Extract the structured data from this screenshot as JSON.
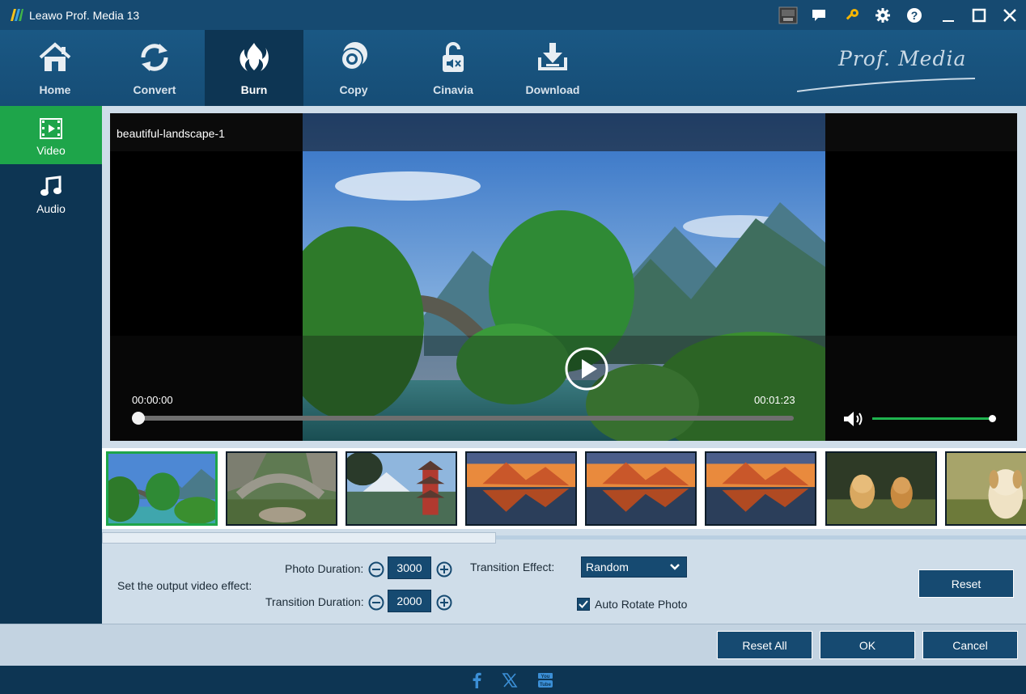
{
  "window": {
    "title": "Leawo Prof. Media 13",
    "controls": [
      "gpu-icon",
      "feedback-icon",
      "key-icon",
      "gear-icon",
      "help-icon",
      "minimize-icon",
      "maximize-icon",
      "close-icon"
    ]
  },
  "nav": {
    "items": [
      {
        "label": "Home",
        "icon": "home-icon"
      },
      {
        "label": "Convert",
        "icon": "convert-icon"
      },
      {
        "label": "Burn",
        "icon": "burn-icon",
        "active": true
      },
      {
        "label": "Copy",
        "icon": "copy-icon"
      },
      {
        "label": "Cinavia",
        "icon": "cinavia-icon"
      },
      {
        "label": "Download",
        "icon": "download-icon"
      }
    ],
    "brand": "Prof. Media"
  },
  "sidebar": {
    "items": [
      {
        "label": "Video",
        "icon": "video-icon",
        "active": true
      },
      {
        "label": "Audio",
        "icon": "music-icon"
      }
    ]
  },
  "player": {
    "file_name": "beautiful-landscape-1",
    "time_current": "00:00:00",
    "time_total": "00:01:23",
    "progress": 0.0,
    "volume": 1.0
  },
  "thumbnails": [
    {
      "name": "thumbnail-bridge-mountains",
      "selected": true
    },
    {
      "name": "thumbnail-stone-bridge"
    },
    {
      "name": "thumbnail-pagoda"
    },
    {
      "name": "thumbnail-sunset-lake-1"
    },
    {
      "name": "thumbnail-sunset-lake-2"
    },
    {
      "name": "thumbnail-sunset-lake-3"
    },
    {
      "name": "thumbnail-puppies"
    },
    {
      "name": "thumbnail-puppy"
    }
  ],
  "settings": {
    "effect_label": "Set the output video effect:",
    "photo_duration_label": "Photo Duration:",
    "photo_duration_value": "3000",
    "transition_duration_label": "Transition Duration:",
    "transition_duration_value": "2000",
    "transition_effect_label": "Transition Effect:",
    "transition_effect_value": "Random",
    "auto_rotate_label": "Auto Rotate Photo",
    "auto_rotate_checked": true,
    "reset_label": "Reset"
  },
  "footer": {
    "reset_all_label": "Reset All",
    "ok_label": "OK",
    "cancel_label": "Cancel"
  },
  "social": [
    "facebook-icon",
    "x-icon",
    "youtube-icon"
  ],
  "colors": {
    "accent_green": "#1ea54a",
    "nav_blue": "#164a71",
    "dark_blue": "#0d3553",
    "panel_bg": "#cfdde9",
    "key_gold": "#f5b400"
  }
}
